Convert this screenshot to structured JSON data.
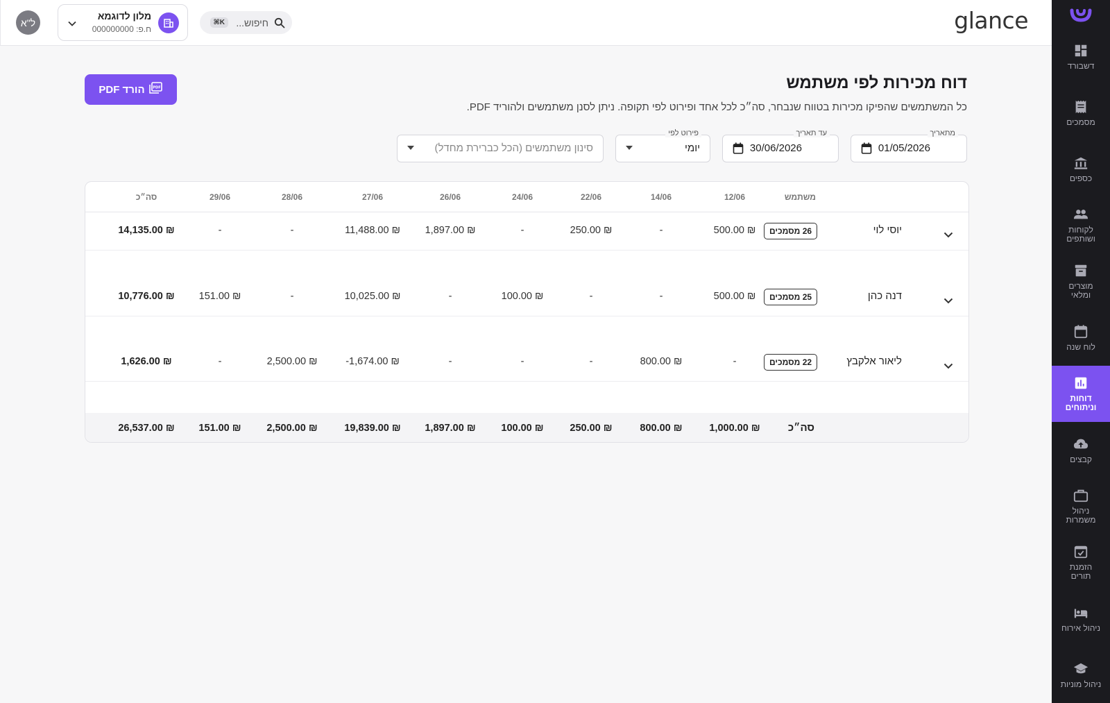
{
  "app": {
    "brand": "glance",
    "avatar_initials": "ל\"א"
  },
  "hotel": {
    "name": "מלון לדוגמא",
    "id_text": "ח.פ: 000000000"
  },
  "search": {
    "placeholder": "חיפוש...",
    "shortcut": "⌘K"
  },
  "sidebar": {
    "items": [
      {
        "label": "דשבורד",
        "icon": "dashboard-icon"
      },
      {
        "label": "מסמכים",
        "icon": "receipt-icon"
      },
      {
        "label": "כספים",
        "icon": "bank-icon"
      },
      {
        "label": "לקוחות ושותפים",
        "icon": "people-icon"
      },
      {
        "label": "מוצרים ומלאי",
        "icon": "inventory-icon"
      },
      {
        "label": "לוח שנה",
        "icon": "calendar-icon"
      },
      {
        "label": "דוחות וניתוחים",
        "icon": "chart-icon",
        "active": true
      },
      {
        "label": "קבצים",
        "icon": "cloud-upload-icon"
      },
      {
        "label": "ניהול משמרות",
        "icon": "briefcase-icon"
      },
      {
        "label": "הזמנת תורים",
        "icon": "event-check-icon"
      },
      {
        "label": "ניהול אירוח",
        "icon": "bed-icon"
      },
      {
        "label": "ניהול מוניות",
        "icon": "school-icon"
      }
    ]
  },
  "page": {
    "title": "דוח מכירות לפי משתמש",
    "subtitle": "כל המשתמשים שהפיקו מכירות בטווח שנבחר, סה״כ לכל אחד ופירוט לפי תקופה. ניתן לסנן משתמשים ולהוריד PDF.",
    "pdf_button": "הורד PDF"
  },
  "filters": {
    "from_label": "מתאריך",
    "from_value": "01/05/2026",
    "to_label": "עד תאריך",
    "to_value": "30/06/2026",
    "breakdown_label": "פירוט לפי",
    "breakdown_value": "יומי",
    "users_placeholder": "סינון משתמשים (הכל כברירת מחדל)"
  },
  "table": {
    "user_header": "משתמש",
    "columns": [
      "12/06",
      "14/06",
      "22/06",
      "24/06",
      "26/06",
      "27/06",
      "28/06",
      "29/06",
      "סה״כ"
    ],
    "rows": [
      {
        "name": "יוסי לוי",
        "docs": "26 מסמכים",
        "cells": [
          "500.00 ₪",
          "-",
          "250.00 ₪",
          "-",
          "1,897.00 ₪",
          "11,488.00 ₪",
          "-",
          "-",
          "14,135.00 ₪"
        ]
      },
      {
        "name": "דנה כהן",
        "docs": "25 מסמכים",
        "cells": [
          "500.00 ₪",
          "-",
          "-",
          "100.00 ₪",
          "-",
          "10,025.00 ₪",
          "-",
          "151.00 ₪",
          "10,776.00 ₪"
        ]
      },
      {
        "name": "ליאור אלקבץ",
        "docs": "22 מסמכים",
        "cells": [
          "-",
          "800.00 ₪",
          "-",
          "-",
          "-",
          "-1,674.00 ₪",
          "2,500.00 ₪",
          "-",
          "1,626.00 ₪"
        ]
      }
    ],
    "footer_label": "סה״כ",
    "footer_cells": [
      "1,000.00 ₪",
      "800.00 ₪",
      "250.00 ₪",
      "100.00 ₪",
      "1,897.00 ₪",
      "19,839.00 ₪",
      "2,500.00 ₪",
      "151.00 ₪",
      "26,537.00 ₪"
    ]
  },
  "colors": {
    "accent": "#7c52f0",
    "sidebar_bg": "#1b1b1f"
  }
}
